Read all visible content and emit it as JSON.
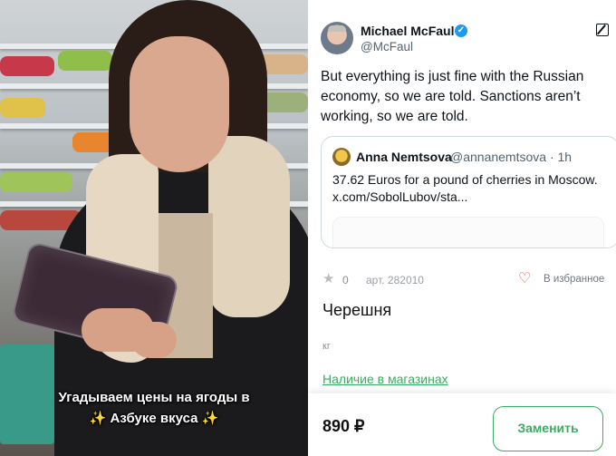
{
  "video": {
    "caption_line1": "Угадываем цены на ягоды в",
    "caption_line2": "✨ Азбуке вкуса ✨"
  },
  "tweet": {
    "author_name": "Michael McFaul",
    "author_handle": "@McFaul",
    "verified_mark": "✓",
    "text": "But everything is just fine with the Russian economy, so we are told. Sanctions aren’t working, so we are told.",
    "icons": {
      "grok": "grok-icon",
      "verified": "verified-badge-icon"
    },
    "quote": {
      "author_name": "Anna Nemtsova",
      "author_handle": "@annanemtsova · 1h",
      "text": "37.62 Euros for a pound of cherries in Moscow.",
      "link": "x.com/SobolLubov/sta..."
    }
  },
  "product": {
    "star_icon": "star-icon",
    "rating_count": "0",
    "article": "арт. 282010",
    "heart_icon": "heart-icon",
    "favorite_label": "В избранное",
    "title": "Черешня",
    "unit": "кг",
    "availability_link": "Наличие в магазинах",
    "price": "890 ₽",
    "replace_button": "Заменить"
  },
  "colors": {
    "accent_green": "#3bab62",
    "link_blue": "#1d9bf0",
    "heart_red": "#d9534f"
  }
}
